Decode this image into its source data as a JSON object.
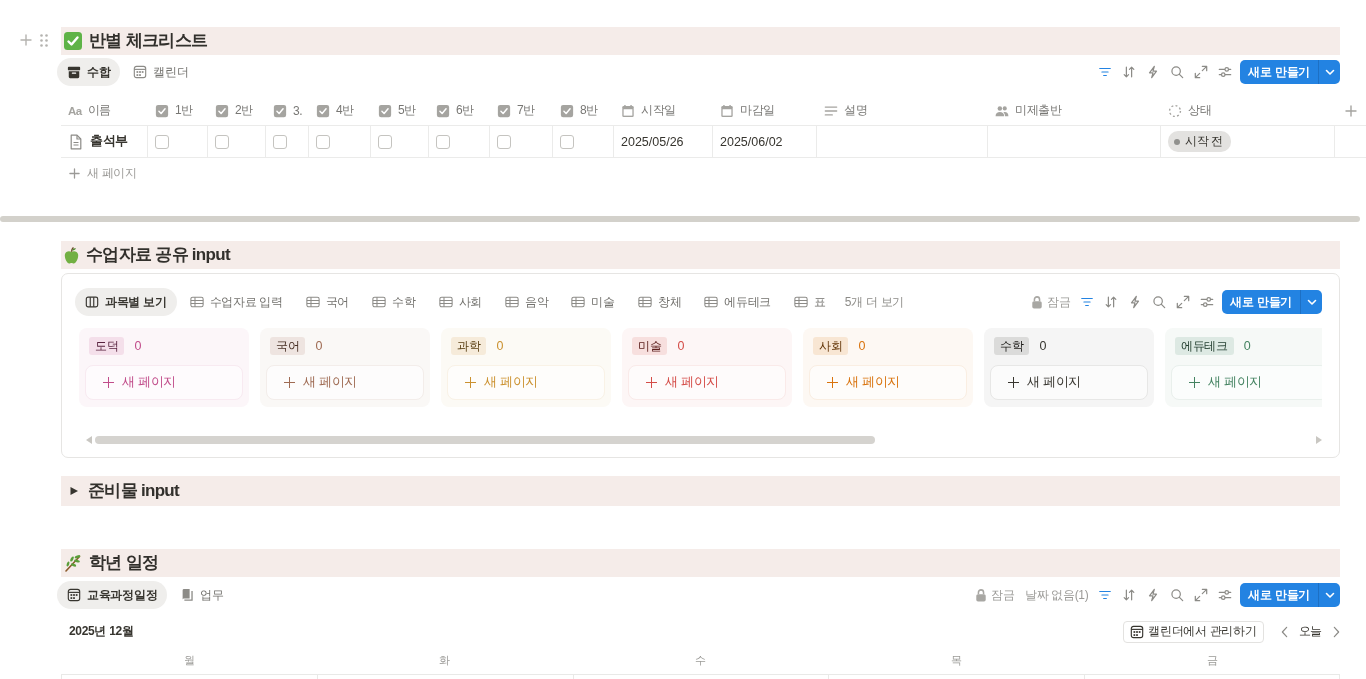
{
  "checklist": {
    "title": "반별 체크리스트",
    "views": [
      {
        "label": "수합",
        "kind": "archive",
        "selected": true
      },
      {
        "label": "캘린더",
        "kind": "calendar",
        "selected": false
      }
    ],
    "toolbar": {
      "filter_on": true,
      "new_button": "새로 만들기"
    },
    "table": {
      "columns": [
        {
          "label": "이름",
          "kind": "title",
          "glyph": "Aa"
        },
        {
          "label": "1반",
          "kind": "checkbox"
        },
        {
          "label": "2반",
          "kind": "checkbox"
        },
        {
          "label": "3.",
          "kind": "checkbox"
        },
        {
          "label": "4반",
          "kind": "checkbox"
        },
        {
          "label": "5반",
          "kind": "checkbox"
        },
        {
          "label": "6반",
          "kind": "checkbox"
        },
        {
          "label": "7반",
          "kind": "checkbox"
        },
        {
          "label": "8반",
          "kind": "checkbox"
        },
        {
          "label": "시작일",
          "kind": "date"
        },
        {
          "label": "마감일",
          "kind": "date"
        },
        {
          "label": "설명",
          "kind": "text"
        },
        {
          "label": "미제출반",
          "kind": "person"
        },
        {
          "label": "상태",
          "kind": "status"
        }
      ],
      "rows": [
        {
          "cells": [
            {
              "text": "출석부"
            },
            {
              "checked": false
            },
            {
              "checked": false
            },
            {
              "checked": false
            },
            {
              "checked": false
            },
            {
              "checked": false
            },
            {
              "checked": false
            },
            {
              "checked": false
            },
            {
              "checked": false
            },
            {
              "text": "2025/05/26"
            },
            {
              "text": "2025/06/02"
            },
            null,
            null,
            {
              "status": "시작 전"
            }
          ]
        }
      ]
    },
    "add_row": "새 페이지"
  },
  "materials": {
    "title": "수업자료 공유 input",
    "views": [
      {
        "label": "과목별 보기",
        "kind": "board",
        "selected": true
      },
      {
        "label": "수업자료 입력",
        "kind": "table",
        "selected": false
      },
      {
        "label": "국어",
        "kind": "table",
        "selected": false
      },
      {
        "label": "수학",
        "kind": "table",
        "selected": false
      },
      {
        "label": "사회",
        "kind": "table",
        "selected": false
      },
      {
        "label": "음악",
        "kind": "table",
        "selected": false
      },
      {
        "label": "미술",
        "kind": "table",
        "selected": false
      },
      {
        "label": "창체",
        "kind": "table",
        "selected": false
      },
      {
        "label": "에듀테크",
        "kind": "table",
        "selected": false
      },
      {
        "label": "표",
        "kind": "table",
        "selected": false
      }
    ],
    "more_views": "5개 더 보기",
    "toolbar": {
      "lock": "잠금",
      "filter_on": true,
      "new_button": "새로 만들기"
    },
    "groups": [
      {
        "label": "도덕",
        "count": "0",
        "color": "#c14c8a",
        "add": "새 페이지"
      },
      {
        "label": "국어",
        "count": "0",
        "color": "#9f6b53",
        "add": "새 페이지"
      },
      {
        "label": "과학",
        "count": "0",
        "color": "#cb912f",
        "add": "새 페이지"
      },
      {
        "label": "미술",
        "count": "0",
        "color": "#d44c47",
        "add": "새 페이지"
      },
      {
        "label": "사회",
        "count": "0",
        "color": "#d9730d",
        "add": "새 페이지"
      },
      {
        "label": "수학",
        "count": "0",
        "color": "#37352f",
        "add": "새 페이지"
      },
      {
        "label": "에듀테크",
        "count": "0",
        "color": "#448361",
        "add": "새 페이지"
      }
    ]
  },
  "supplies": {
    "title": "준비물 input",
    "expanded": false
  },
  "schedule": {
    "title": "학년 일정",
    "views": [
      {
        "label": "교육과정일정",
        "kind": "calendar",
        "selected": true
      },
      {
        "label": "업무",
        "kind": "book",
        "selected": false
      }
    ],
    "toolbar": {
      "lock": "잠금",
      "no_date": "날짜 없음(1)",
      "filter_on": true,
      "new_button": "새로 만들기"
    },
    "calendar": {
      "month": "2025년 12월",
      "manage_button": "캘린더에서 관리하기",
      "today": "오늘",
      "weekdays": [
        "월",
        "화",
        "수",
        "목",
        "금"
      ]
    }
  }
}
